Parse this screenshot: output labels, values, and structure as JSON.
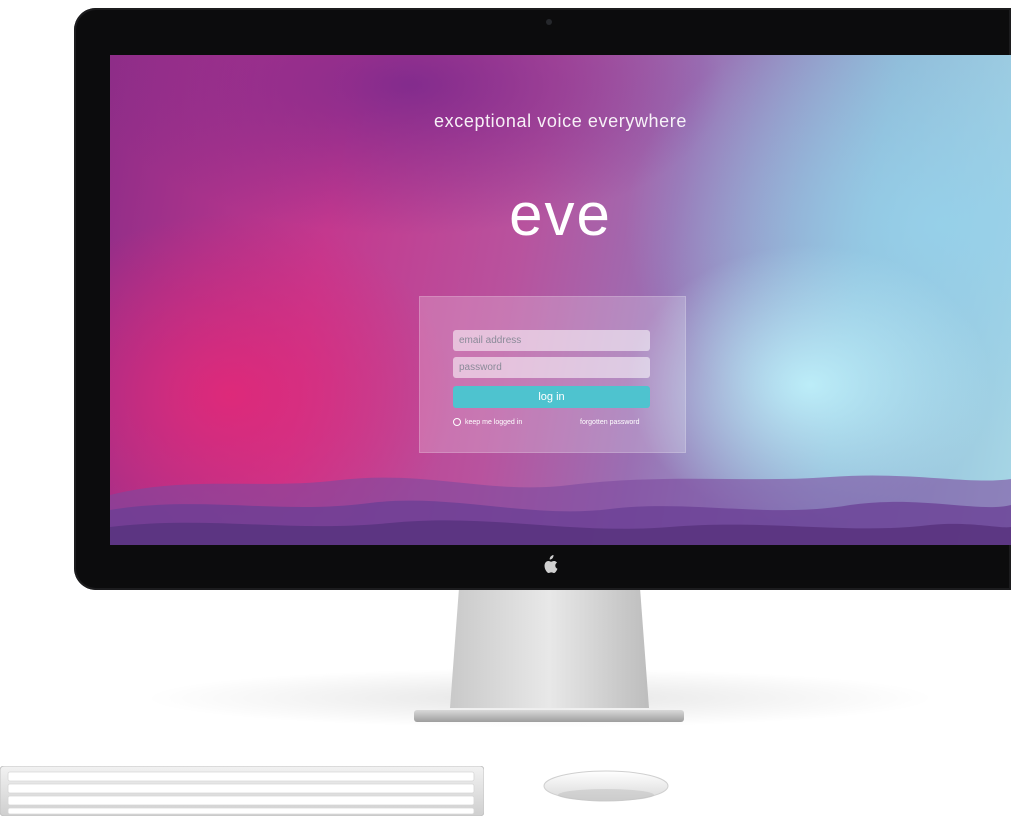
{
  "screen": {
    "tagline": "exceptional voice everywhere",
    "logo_text": "eve"
  },
  "login": {
    "email_placeholder": "email address",
    "password_placeholder": "password",
    "login_label": "log in",
    "remember_label": "keep me logged in",
    "forgot_label": "forgotten password"
  },
  "colors": {
    "accent": "#4ec3cf",
    "bezel": "#0c0c0d"
  },
  "icons": {
    "chin": "apple-logo-icon",
    "remember": "radio-icon"
  }
}
